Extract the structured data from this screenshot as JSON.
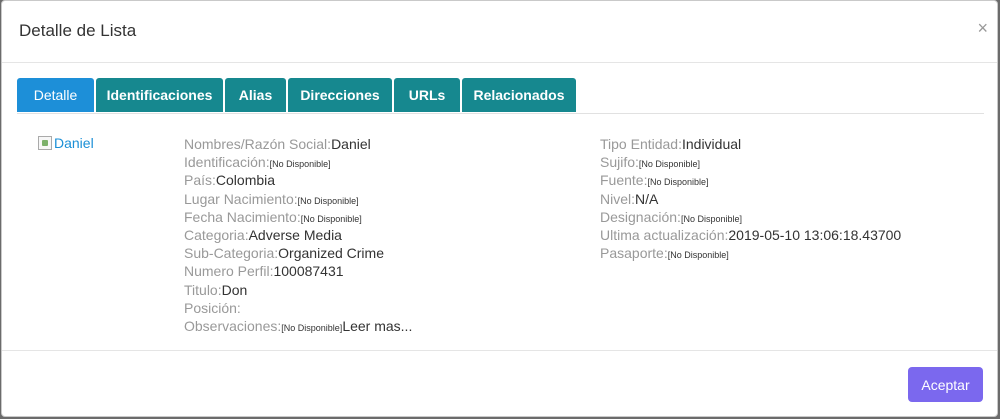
{
  "modal": {
    "title": "Detalle de Lista",
    "close_icon": "×"
  },
  "tabs": [
    {
      "label": "Detalle",
      "active": true
    },
    {
      "label": "Identificaciones",
      "active": false
    },
    {
      "label": "Alias",
      "active": false
    },
    {
      "label": "Direcciones",
      "active": false
    },
    {
      "label": "URLs",
      "active": false
    },
    {
      "label": "Relacionados",
      "active": false
    }
  ],
  "photo": {
    "alt": "Daniel"
  },
  "left_fields": [
    {
      "label": "Nombres/Razón Social:",
      "value": "Daniel"
    },
    {
      "label": "Identificación:",
      "value": "[No Disponible]",
      "na": true
    },
    {
      "label": "País:",
      "value": "Colombia"
    },
    {
      "label": "Lugar Nacimiento:",
      "value": "[No Disponible]",
      "na": true
    },
    {
      "label": "Fecha Nacimiento:",
      "value": "[No Disponible]",
      "na": true
    },
    {
      "label": "Categoria:",
      "value": "Adverse Media"
    },
    {
      "label": "Sub-Categoria:",
      "value": "Organized Crime"
    },
    {
      "label": "Numero Perfil:",
      "value": "100087431"
    },
    {
      "label": "Titulo:",
      "value": "Don"
    },
    {
      "label": "Posición:",
      "value": ""
    },
    {
      "label": "Observaciones:",
      "value": "[No Disponible]",
      "na": true,
      "extra": "Leer mas..."
    }
  ],
  "right_fields": [
    {
      "label": "Tipo Entidad:",
      "value": "Individual"
    },
    {
      "label": "Sujifo:",
      "value": "[No Disponible]",
      "na": true
    },
    {
      "label": "Fuente:",
      "value": "[No Disponible]",
      "na": true
    },
    {
      "label": "Nivel:",
      "value": "N/A"
    },
    {
      "label": "Designación:",
      "value": "[No Disponible]",
      "na": true
    },
    {
      "label": "Ultima actualización:",
      "value": "2019-05-10 13:06:18.43700"
    },
    {
      "label": "Pasaporte:",
      "value": "[No Disponible]",
      "na": true
    }
  ],
  "footer": {
    "accept_label": "Aceptar"
  },
  "colors": {
    "tab_bg": "#16888f",
    "tab_active_bg": "#1d8fd8",
    "accept_bg": "#7b68ee",
    "label_color": "#999999",
    "value_color": "#333333"
  }
}
